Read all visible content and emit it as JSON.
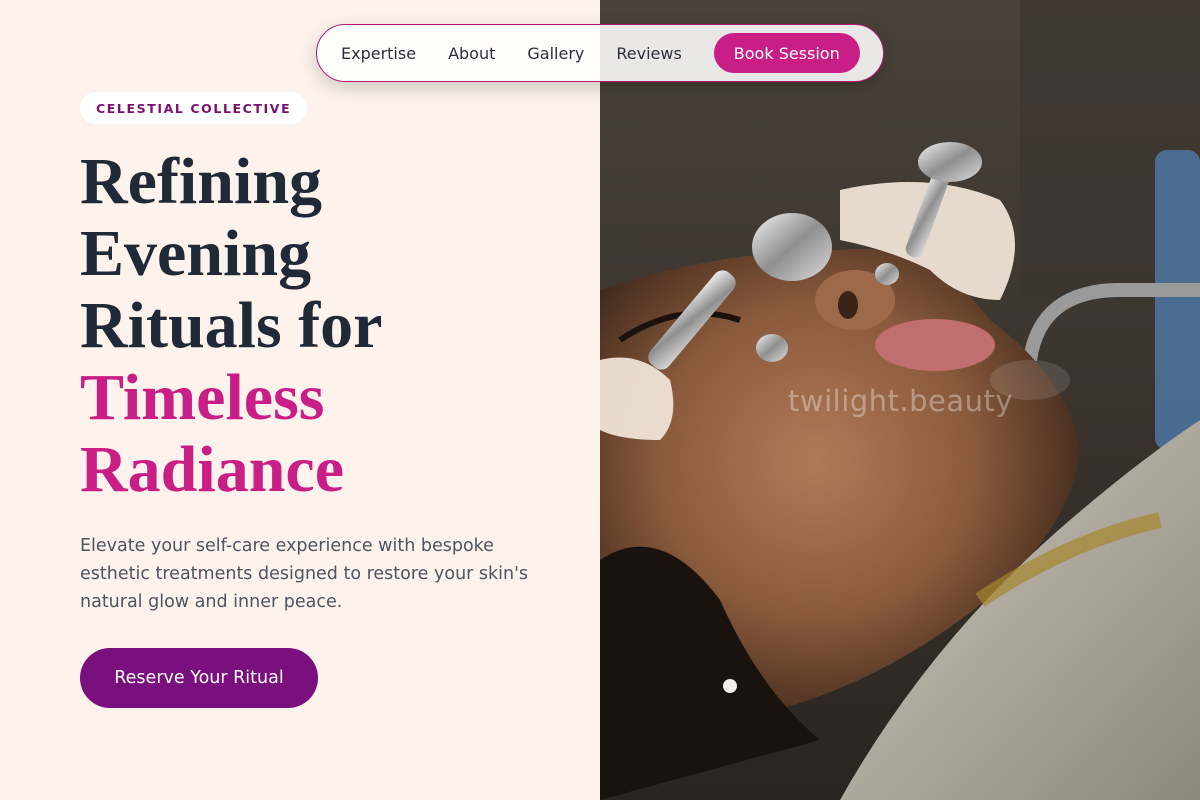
{
  "nav": {
    "links": [
      "Expertise",
      "About",
      "Gallery",
      "Reviews"
    ],
    "book_label": "Book Session"
  },
  "hero": {
    "eyebrow": "CELESTIAL COLLECTIVE",
    "headline_dark": [
      "Refining",
      "Evening",
      "Rituals for"
    ],
    "headline_accent": [
      "Timeless",
      "Radiance"
    ],
    "description": "Elevate your self-care experience with bespoke esthetic treatments designed to restore your skin's natural glow and inner peace.",
    "cta_label": "Reserve Your Ritual"
  },
  "image": {
    "watermark": "twilight.beauty"
  },
  "colors": {
    "accent": "#c81e86",
    "cta": "#7a0f7e",
    "eyebrow_text": "#7a0f6e",
    "background": "#fdf3ec",
    "heading": "#1f2937"
  }
}
